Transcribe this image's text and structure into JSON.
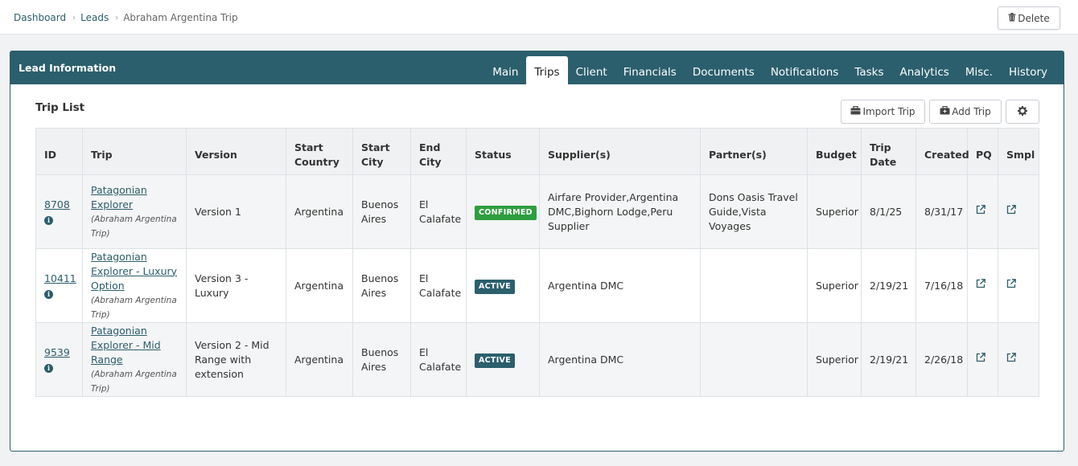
{
  "breadcrumb": {
    "dashboard": "Dashboard",
    "leads": "Leads",
    "current": "Abraham Argentina Trip",
    "sep": "›"
  },
  "actions": {
    "delete_label": "Delete"
  },
  "panel": {
    "title": "Lead Information",
    "tabs": [
      "Main",
      "Trips",
      "Client",
      "Financials",
      "Documents",
      "Notifications",
      "Tasks",
      "Analytics",
      "Misc.",
      "History"
    ],
    "active_tab": "Trips"
  },
  "trip_list": {
    "title": "Trip List",
    "import_label": "Import Trip",
    "add_label": "Add Trip",
    "columns": [
      "ID",
      "Trip",
      "Version",
      "Start Country",
      "Start City",
      "End City",
      "Status",
      "Supplier(s)",
      "Partner(s)",
      "Budget",
      "Trip Date",
      "Created",
      "PQ",
      "Smpl"
    ],
    "rows": [
      {
        "id": "8708",
        "trip": "Patagonian Explorer",
        "subtitle": "(Abraham Argentina Trip)",
        "version": "Version 1",
        "start_country": "Argentina",
        "start_city": "Buenos Aires",
        "end_city": "El Calafate",
        "status": "CONFIRMED",
        "suppliers": "Airfare Provider,Argentina DMC,Bighorn Lodge,Peru Supplier",
        "partners": "Dons Oasis Travel Guide,Vista Voyages",
        "budget": "Superior",
        "trip_date": "8/1/25",
        "created": "8/31/17"
      },
      {
        "id": "10411",
        "trip": "Patagonian Explorer - Luxury Option",
        "subtitle": "(Abraham Argentina Trip)",
        "version": "Version 3 - Luxury",
        "start_country": "Argentina",
        "start_city": "Buenos Aires",
        "end_city": "El Calafate",
        "status": "ACTIVE",
        "suppliers": "Argentina DMC",
        "partners": "",
        "budget": "Superior",
        "trip_date": "2/19/21",
        "created": "7/16/18"
      },
      {
        "id": "9539",
        "trip": "Patagonian Explorer - Mid Range",
        "subtitle": "(Abraham Argentina Trip)",
        "version": "Version 2 - Mid Range with extension",
        "start_country": "Argentina",
        "start_city": "Buenos Aires",
        "end_city": "El Calafate",
        "status": "ACTIVE",
        "suppliers": "Argentina DMC",
        "partners": "",
        "budget": "Superior",
        "trip_date": "2/19/21",
        "created": "2/26/18"
      }
    ]
  },
  "icons": {
    "delete": "trash-icon",
    "import": "briefcase-icon",
    "add": "briefcase-plus-icon",
    "settings": "gear-icon",
    "info": "info-icon",
    "external": "external-link-icon"
  },
  "colors": {
    "primary": "#2b5f6d",
    "confirmed": "#2e9e3e",
    "active": "#2b5f6d"
  }
}
